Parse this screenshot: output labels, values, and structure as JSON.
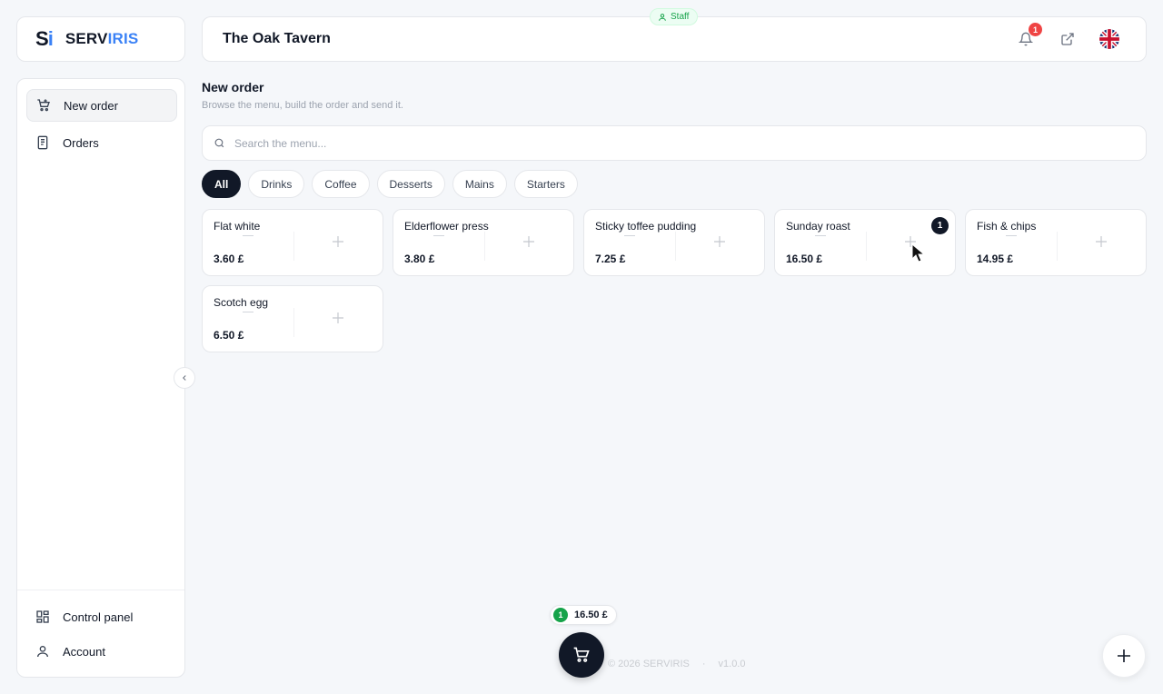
{
  "brand": {
    "mark_s": "S",
    "mark_i": "i",
    "name_a": "SERV",
    "name_b": "IRIS"
  },
  "header": {
    "title": "The Oak Tavern",
    "staff_badge": "Staff",
    "notification_count": "1",
    "icons": [
      "bell-icon",
      "external-link-icon",
      "uk-flag-icon"
    ]
  },
  "sidebar": {
    "items": [
      {
        "label": "New order",
        "icon": "cart-plus-icon",
        "active": true
      },
      {
        "label": "Orders",
        "icon": "receipt-icon",
        "active": false
      }
    ],
    "bottom_items": [
      {
        "label": "Control panel",
        "icon": "dashboard-icon"
      },
      {
        "label": "Account",
        "icon": "user-icon"
      }
    ]
  },
  "page": {
    "title": "New order",
    "subtitle": "Browse the menu, build the order and send it."
  },
  "search": {
    "placeholder": "Search the menu..."
  },
  "categories": [
    "All",
    "Drinks",
    "Coffee",
    "Desserts",
    "Mains",
    "Starters"
  ],
  "active_category": "All",
  "products": [
    {
      "name": "Flat white",
      "price": "3.60 £",
      "qty": ""
    },
    {
      "name": "Elderflower press",
      "price": "3.80 £",
      "qty": ""
    },
    {
      "name": "Sticky toffee pudding",
      "price": "7.25 £",
      "qty": ""
    },
    {
      "name": "Sunday roast",
      "price": "16.50 £",
      "qty": "1"
    },
    {
      "name": "Fish & chips",
      "price": "14.95 £",
      "qty": ""
    },
    {
      "name": "Scotch egg",
      "price": "6.50 £",
      "qty": ""
    }
  ],
  "cart": {
    "count": "1",
    "total": "16.50 £"
  },
  "footer": {
    "copyright": "© 2026 SERVIRIS",
    "separator": "·",
    "version": "v1.0.0"
  },
  "colors": {
    "accent": "#3b82f6",
    "dark": "#111827",
    "success": "#16a34a",
    "danger": "#ef4444"
  }
}
